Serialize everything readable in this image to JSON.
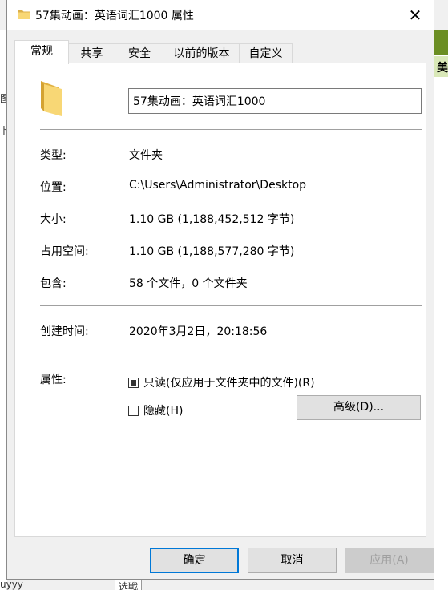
{
  "background": {
    "right_text": "美",
    "left_texts": [
      "图",
      "卜相"
    ],
    "bottom_left": "uyyy",
    "bottom_mid": "选戦"
  },
  "window": {
    "title": "57集动画：英语词汇1000 属性",
    "close_glyph": "✕"
  },
  "tabs": [
    {
      "label": "常规",
      "active": true
    },
    {
      "label": "共享",
      "active": false
    },
    {
      "label": "安全",
      "active": false
    },
    {
      "label": "以前的版本",
      "active": false
    },
    {
      "label": "自定义",
      "active": false
    }
  ],
  "general": {
    "name": "57集动画：英语词汇1000",
    "type_label": "类型:",
    "type_value": "文件夹",
    "location_label": "位置:",
    "location_value": "C:\\Users\\Administrator\\Desktop",
    "size_label": "大小:",
    "size_value": "1.10 GB (1,188,452,512 字节)",
    "disk_size_label": "占用空间:",
    "disk_size_value": "1.10 GB (1,188,577,280 字节)",
    "contains_label": "包含:",
    "contains_value": "58 个文件，0 个文件夹",
    "created_label": "创建时间:",
    "created_value": "2020年3月2日，20:18:56",
    "attributes_label": "属性:",
    "readonly_label": "只读(仅应用于文件夹中的文件)(R)",
    "readonly_state": "indeterminate",
    "hidden_label": "隐藏(H)",
    "hidden_state": "unchecked",
    "advanced_label": "高级(D)..."
  },
  "footer": {
    "ok_label": "确定",
    "cancel_label": "取消",
    "apply_label": "应用(A)"
  },
  "colors": {
    "folder_yellow": "#f8d775",
    "folder_dark": "#e0b040",
    "accent": "#0078d7"
  }
}
